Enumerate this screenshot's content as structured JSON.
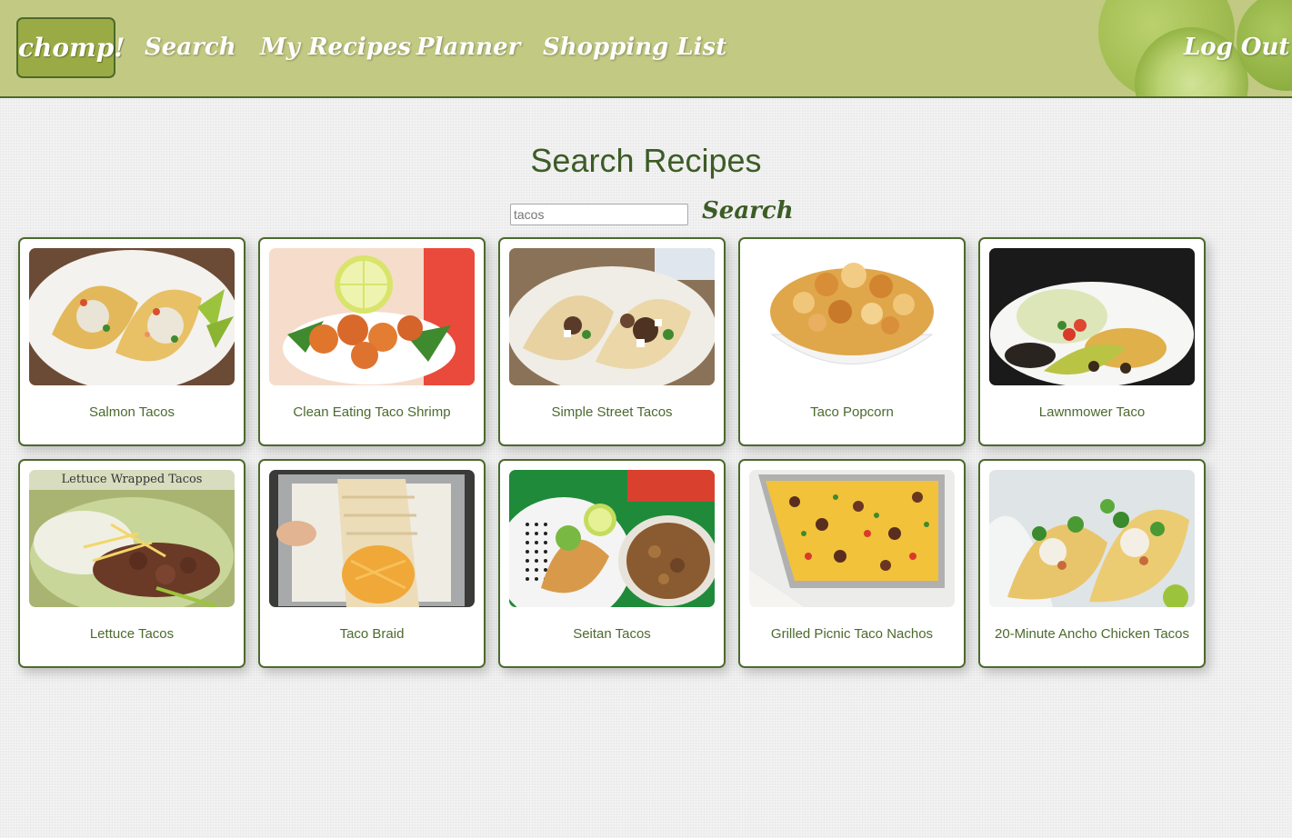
{
  "nav": {
    "logo": "chomp!",
    "links": {
      "search": "Search",
      "my_recipes": "My Recipes",
      "planner": "Planner",
      "shopping_list": "Shopping List",
      "log_out": "Log Out"
    }
  },
  "page": {
    "title": "Search Recipes"
  },
  "search": {
    "placeholder": "tacos",
    "value": "",
    "button_label": "Search"
  },
  "recipes": [
    {
      "title": "Salmon Tacos",
      "image_icon": "tacos-photo"
    },
    {
      "title": "Clean Eating Taco Shrimp",
      "image_icon": "shrimp-photo"
    },
    {
      "title": "Simple Street Tacos",
      "image_icon": "street-tacos-photo"
    },
    {
      "title": "Taco Popcorn",
      "image_icon": "popcorn-photo"
    },
    {
      "title": "Lawnmower Taco",
      "image_icon": "taco-bowl-photo"
    },
    {
      "title": "Lettuce Tacos",
      "image_icon": "lettuce-tacos-photo",
      "image_caption": "Lettuce Wrapped Tacos"
    },
    {
      "title": "Taco Braid",
      "image_icon": "braid-photo"
    },
    {
      "title": "Seitan Tacos",
      "image_icon": "seitan-tacos-photo"
    },
    {
      "title": "Grilled Picnic Taco Nachos",
      "image_icon": "nachos-photo"
    },
    {
      "title": "20-Minute Ancho Chicken Tacos",
      "image_icon": "chicken-tacos-photo"
    }
  ],
  "colors": {
    "navbar": "#c2c982",
    "accent_green": "#4c6a2c",
    "title_green": "#3c5c25",
    "logo_bg": "#9aab45"
  }
}
